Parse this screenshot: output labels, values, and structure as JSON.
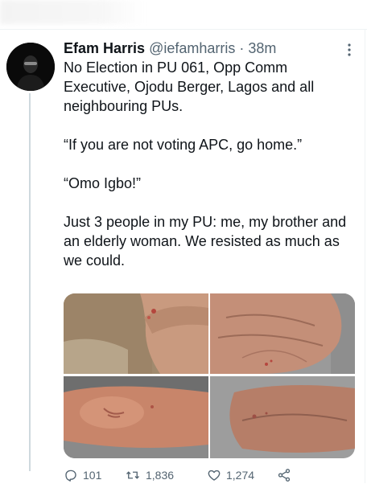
{
  "tweet": {
    "author_name": "Efam Harris",
    "author_handle": "@iefamharris",
    "separator": "·",
    "time": "38m",
    "paragraphs": [
      "No Election in PU 061, Opp Comm Executive, Ojodu Berger, Lagos and all neighbouring PUs.",
      "“If you are not voting APC, go home.”",
      "“Omo Igbo!”",
      "Just 3 people in my PU: me, my brother and an elderly woman. We resisted as much as we could."
    ],
    "media_count": 4
  },
  "actions": {
    "reply_count": "101",
    "retweet_count": "1,836",
    "like_count": "1,274"
  },
  "icons": {
    "more": "more-options-icon",
    "reply": "reply-icon",
    "retweet": "retweet-icon",
    "like": "heart-icon",
    "share": "share-icon"
  },
  "colors": {
    "text": "#0f1419",
    "secondary": "#536471",
    "divider": "#eff3f4"
  }
}
